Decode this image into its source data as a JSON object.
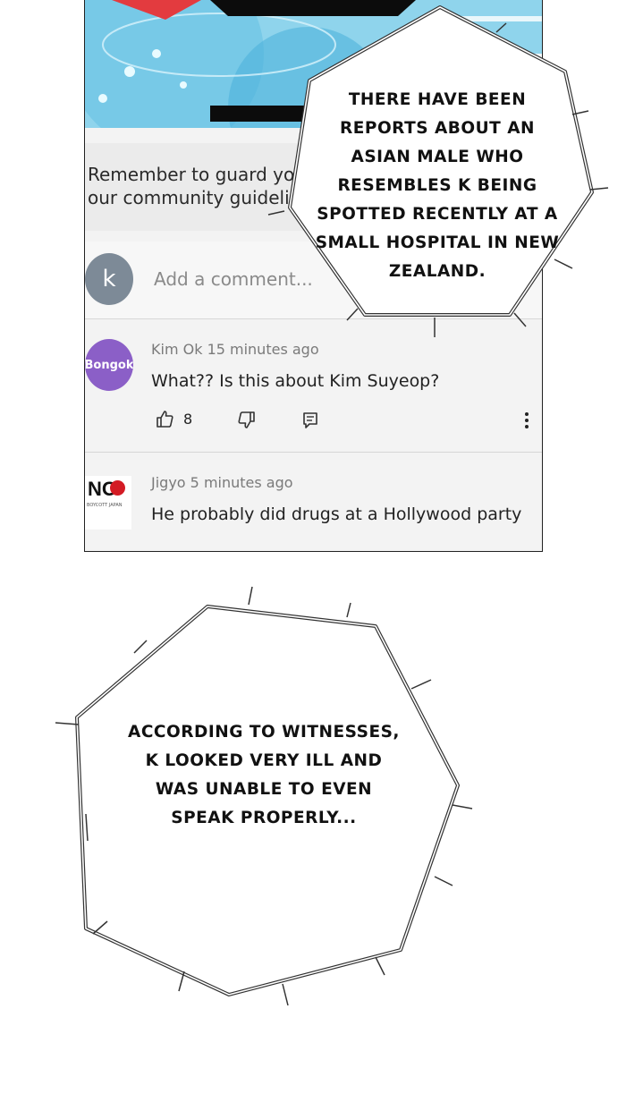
{
  "guidelines_text": "Remember to guard your privacy and abide by our community guidelines.",
  "add_comment_placeholder": "Add a comment...",
  "current_user_initial": "k",
  "comments": [
    {
      "author": "Kim Ok",
      "time": "15 minutes ago",
      "avatar_label": "Bongok",
      "text": "What?? Is this about Kim Suyeop?",
      "likes": "8"
    },
    {
      "author": "Jigyo",
      "time": "5 minutes ago",
      "avatar_label": "NO",
      "avatar_subtext": "BOYCOTT JAPAN",
      "text": "He probably did drugs at a Hollywood party"
    }
  ],
  "bubbles": {
    "top": "THERE HAVE BEEN REPORTS ABOUT AN ASIAN MALE WHO RESEMBLES K BEING SPOTTED RECENTLY AT A SMALL HOSPITAL IN NEW ZEALAND.",
    "bottom": "ACCORDING TO WITNESSES, K LOOKED VERY ILL AND WAS UNABLE TO EVEN SPEAK PROPERLY..."
  },
  "colors": {
    "avatar_k": "#7d8a97",
    "avatar_bongok": "#8b5fc7",
    "no_dot": "#d31b24",
    "panel_bg": "#f3f3f3"
  }
}
